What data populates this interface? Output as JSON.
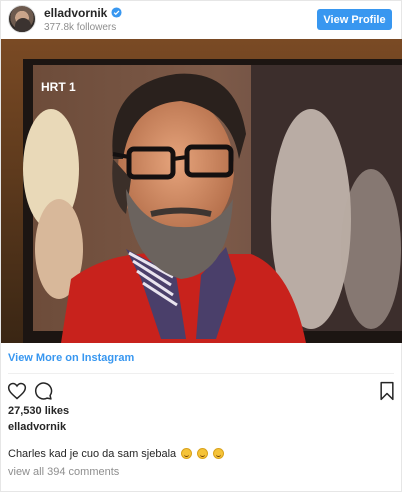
{
  "header": {
    "username": "elladvornik",
    "followers": "377.8k followers",
    "view_profile_label": "View Profile"
  },
  "photo": {
    "tv_channel_logo": "HRT 1"
  },
  "view_more_label": "View More on Instagram",
  "actions": {
    "like_icon": "heart-icon",
    "comment_icon": "comment-icon",
    "save_icon": "bookmark-icon"
  },
  "likes": "27,530 likes",
  "caption": {
    "username": "elladvornik",
    "text": "Charles kad je cuo da sam sjebala",
    "emoji_count": 3
  },
  "view_comments_label": "view all 394 comments",
  "colors": {
    "accent": "#3897f0",
    "text": "#262626",
    "muted": "#8e8e8e"
  }
}
